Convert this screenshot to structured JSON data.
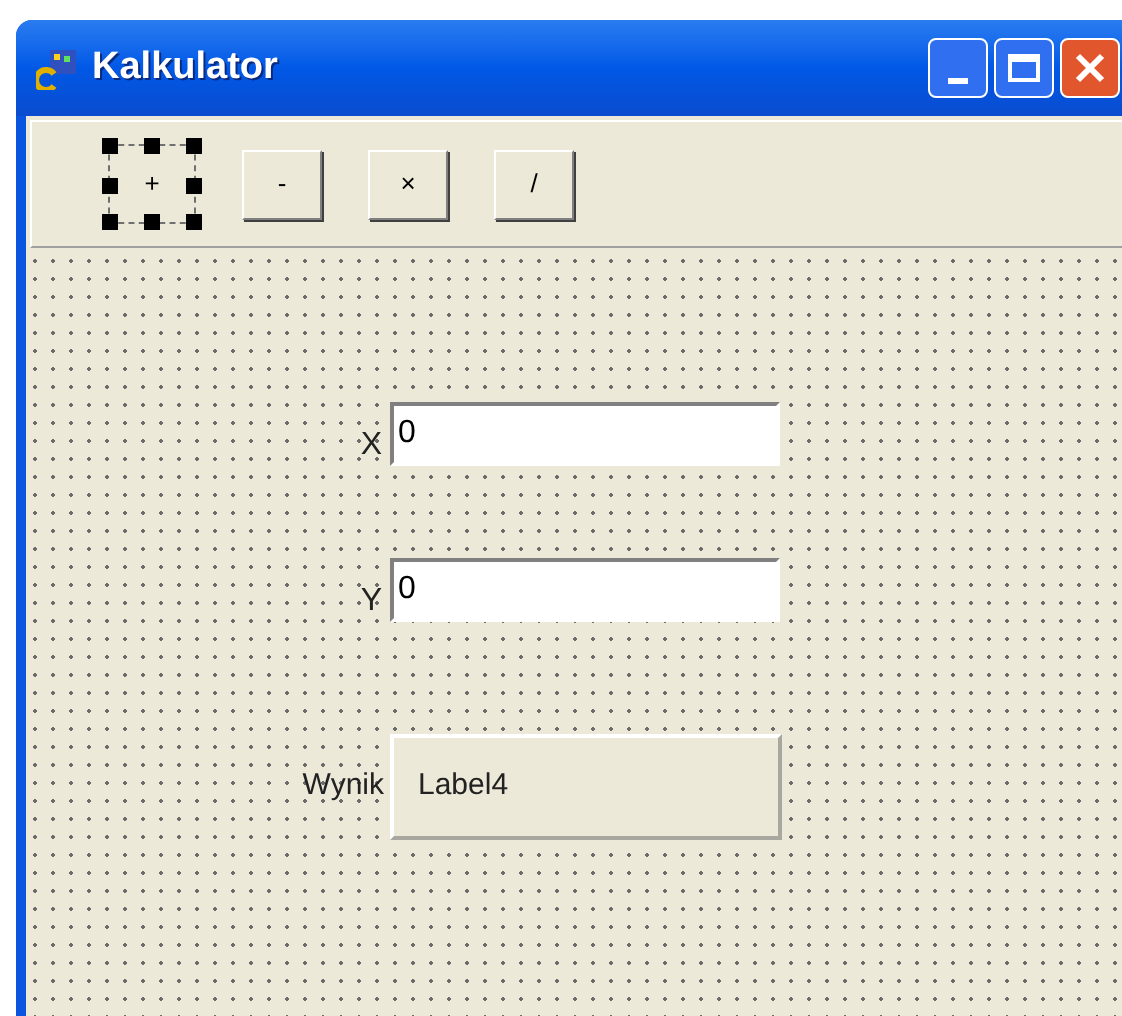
{
  "window": {
    "title": "Kalkulator"
  },
  "toolbar": {
    "buttons": [
      {
        "label": "+",
        "selected": true
      },
      {
        "label": "-",
        "selected": false
      },
      {
        "label": "×",
        "selected": false
      },
      {
        "label": "/",
        "selected": false
      }
    ]
  },
  "form": {
    "fields": [
      {
        "label": "X",
        "value": "0"
      },
      {
        "label": "Y",
        "value": "0"
      }
    ],
    "result": {
      "label": "Wynik",
      "value": "Label4"
    }
  }
}
